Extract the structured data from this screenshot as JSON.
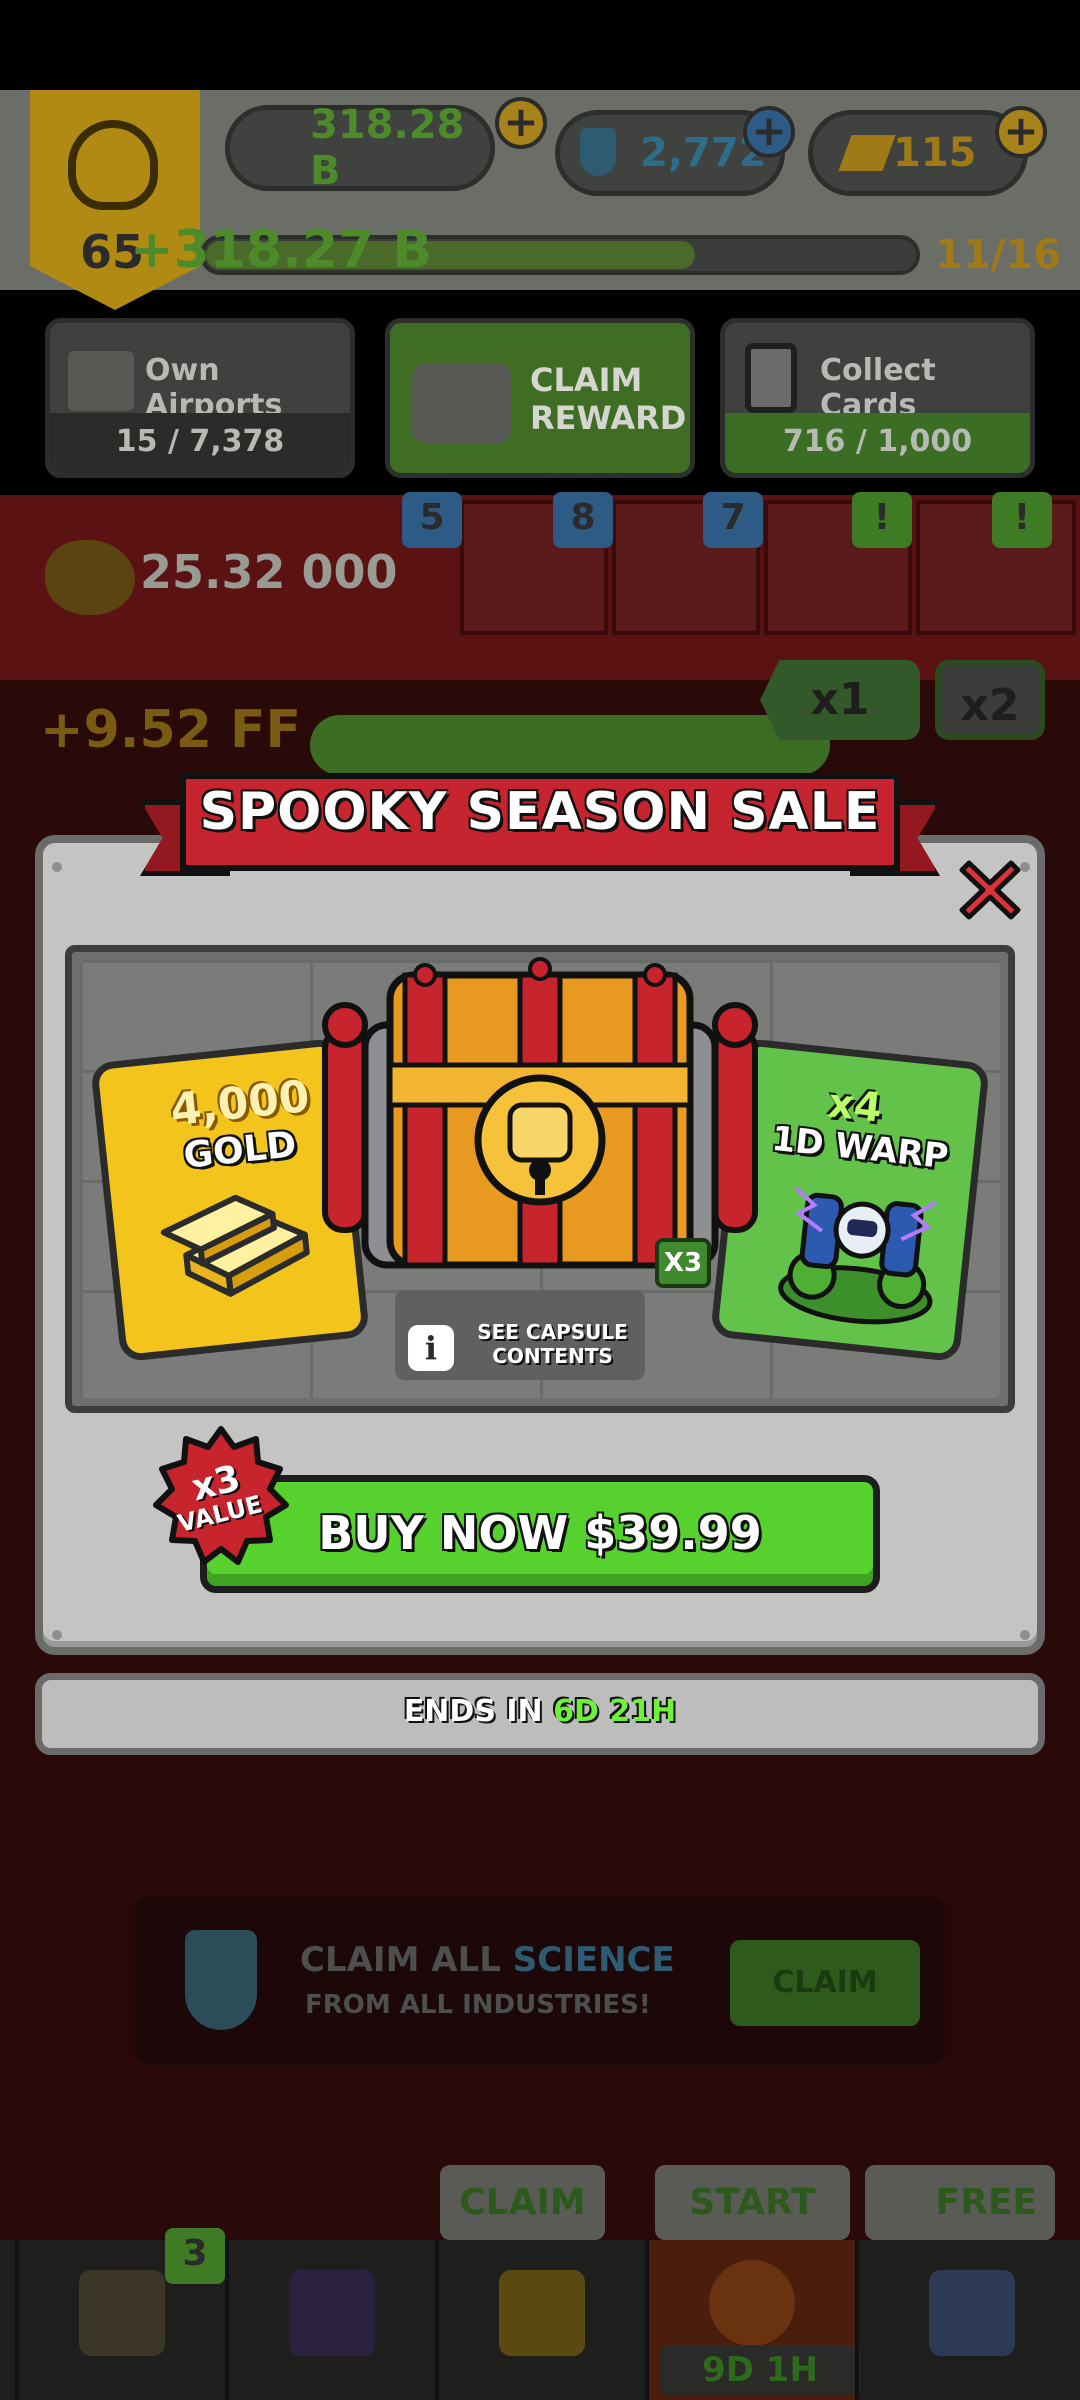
{
  "hud": {
    "rank_level": "65",
    "combat_power": "318.28 B",
    "science": "2,772",
    "gold": "115",
    "xp_gain": "+318.27 B",
    "xp_progress_fraction": 0.69,
    "xp_count": "11/16"
  },
  "tiles": {
    "airports_title": "Own Airports",
    "airports_progress": "15 / 7,378",
    "claim_reward_label": "CLAIM REWARD",
    "cards_title": "Collect Cards",
    "cards_progress": "716 / 1,000"
  },
  "resources": {
    "money": "25.32 000",
    "badges": [
      "5",
      "8",
      "7",
      "!",
      "!"
    ]
  },
  "multiplier": {
    "x1": "x1",
    "x2": "x2",
    "earn_rate": "+9.52 FF"
  },
  "modal": {
    "title": "SPOOKY SEASON SALE",
    "gold_amount": "4,000",
    "gold_label": "GOLD",
    "capsule_count": "X3",
    "see_contents": "SEE CAPSULE CONTENTS",
    "warp_multiplier": "x4",
    "warp_label": "1D WARP",
    "value_multiplier": "x3",
    "value_label": "VALUE",
    "buy_label": "BUY NOW $39.99",
    "ends_prefix": "ENDS IN",
    "ends_days": "6D",
    "ends_hours": "21H",
    "colors": {
      "ribbon": "#c6242f",
      "buy_button": "#57d12e",
      "gold_card": "#f2c41c",
      "warp_card": "#62c24a"
    }
  },
  "science_banner": {
    "line1_a": "CLAIM ALL",
    "line1_b": "SCIENCE",
    "line2": "FROM ALL INDUSTRIES!",
    "claim_label": "CLAIM"
  },
  "bottom": {
    "tab_claim": "CLAIM",
    "tab_start": "START",
    "tab_free": "FREE",
    "flag_badge": "3",
    "event_timer": "9D 1H"
  }
}
